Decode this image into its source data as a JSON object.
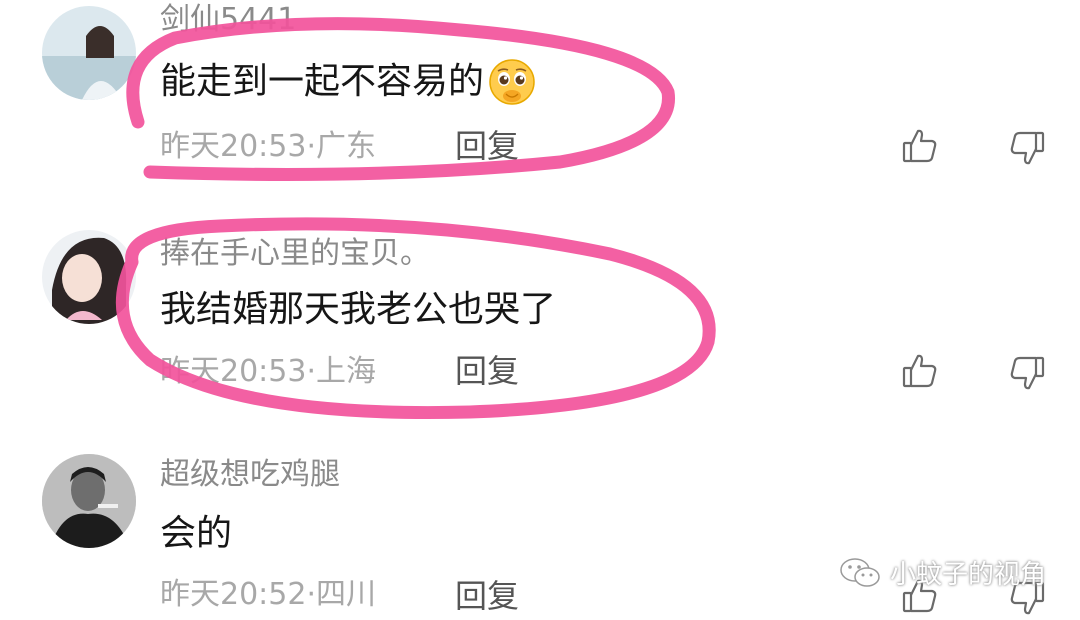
{
  "comments": [
    {
      "username": "剑仙5441",
      "text": "能走到一起不容易的",
      "emoji": "pleading-face",
      "time": "昨天20:53·广东",
      "reply_label": "回复"
    },
    {
      "username": "捧在手心里的宝贝。",
      "text": "我结婚那天我老公也哭了",
      "time": "昨天20:53·上海",
      "reply_label": "回复"
    },
    {
      "username": "超级想吃鸡腿",
      "text": "会的",
      "time": "昨天20:52·四川",
      "reply_label": "回复"
    }
  ],
  "icons": {
    "like": "thumbs-up-icon",
    "dislike": "thumbs-down-icon"
  },
  "watermark": {
    "text": "小蚊子的视角",
    "icon": "wechat-icon"
  },
  "colors": {
    "highlight": "#f2539b",
    "username": "#8a8a8a",
    "text": "#161616",
    "meta": "#a8a8a8"
  }
}
